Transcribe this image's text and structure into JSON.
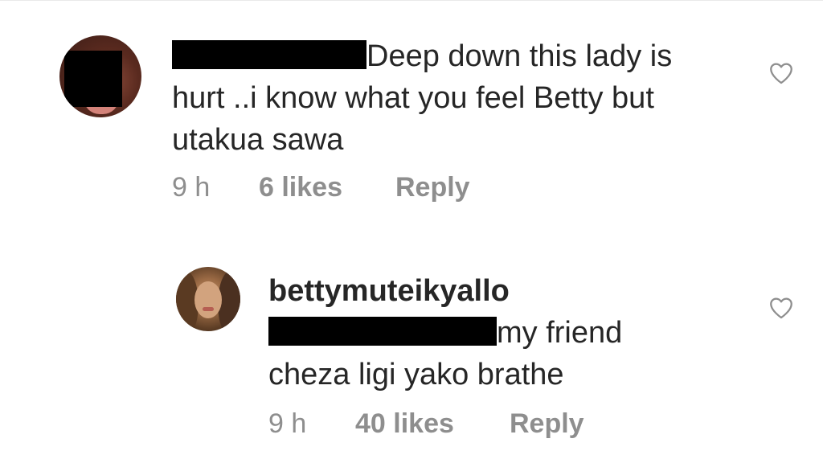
{
  "comments": [
    {
      "text_line1": "Deep down this lady is",
      "text_line2": "hurt ..i know what you feel Betty but",
      "text_line3": "utakua sawa",
      "time": "9 h",
      "likes": "6 likes",
      "reply": "Reply",
      "like_icon": "heart-outline-icon"
    },
    {
      "username": "bettymuteikyallo",
      "text_line1": "my friend",
      "text_line2": "cheza ligi yako brathe",
      "time": "9 h",
      "likes": "40 likes",
      "reply": "Reply",
      "like_icon": "heart-outline-icon"
    }
  ],
  "colors": {
    "text": "#262626",
    "meta": "#8e8e8e",
    "redaction": "#000000"
  }
}
